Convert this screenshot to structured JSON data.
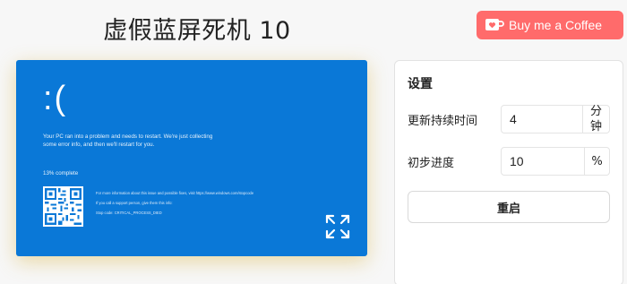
{
  "header": {
    "title": "虚假蓝屏死机 10",
    "coffee_button": "Buy me a Coffee"
  },
  "bsod": {
    "face": ":(",
    "message": "Your PC ran into a problem and needs to restart. We're just collecting some error info, and then we'll restart for you.",
    "progress": "13% complete",
    "info_line": "For more information about this issue and possible fixes, visit https://www.windows.com/stopcode",
    "support_line": "If you call a support person, give them this info:",
    "stop_code": "Stop code: CRITICAL_PROCESS_DIED",
    "background_color": "#0a78d7"
  },
  "settings": {
    "title": "设置",
    "duration_label": "更新持续时间",
    "duration_value": "4",
    "duration_unit": "分钟",
    "progress_label": "初步进度",
    "progress_value": "10",
    "progress_unit": "%",
    "restart_button": "重启"
  },
  "icons": {
    "coffee": "coffee-cup-icon",
    "fullscreen": "expand-icon"
  },
  "colors": {
    "accent": "#ff6b6b",
    "bsod_blue": "#0a78d7"
  }
}
